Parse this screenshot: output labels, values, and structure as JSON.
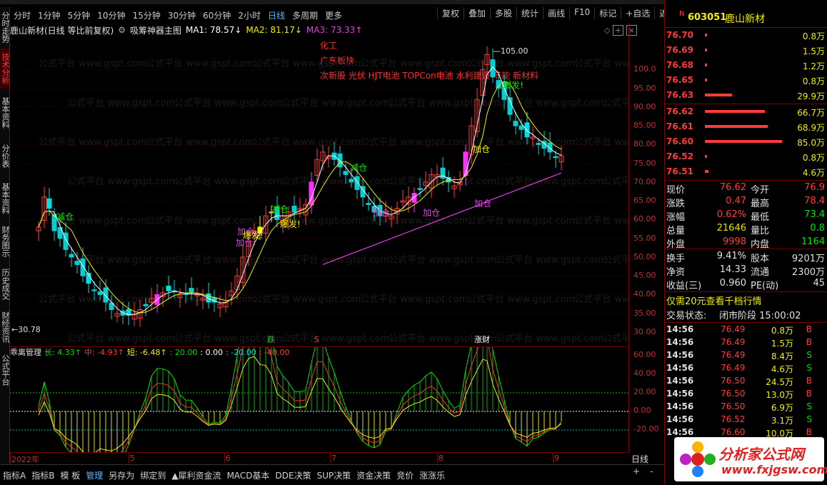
{
  "toolbar": {
    "left": [
      "分时",
      "1分钟",
      "5分钟",
      "10分钟",
      "15分钟",
      "30分钟",
      "60分钟",
      "2小时",
      "日线",
      "多周期",
      "更多"
    ],
    "active": "日线",
    "right": [
      "复权",
      "叠加",
      "多股",
      "统计",
      "画线",
      "F10",
      "标记",
      "+自选",
      "返回"
    ]
  },
  "lefttabs": [
    "分时走势",
    "技术分析",
    "基本资料",
    "分价表",
    "基本资料",
    "财务图示",
    "历史成交",
    "财经资讯",
    "公式平台"
  ],
  "info": {
    "title": "鹿山新材(日线 等比前复权)",
    "indicator": "吸筹神器主图",
    "ma1": "MA1: 78.57↓",
    "ma2": "MA2: 81.17↓",
    "ma3": "MA3: 73.33↑"
  },
  "annotations": {
    "line1": "化工",
    "line2": "广东板块",
    "line3": "次新股 光伏 HJT电池 TOPCon电池 水利建设 节能 新材料"
  },
  "price_labels": {
    "high": "105.00",
    "low": "30.78"
  },
  "signals": [
    "减仓",
    "减仓",
    "减仓",
    "加仓",
    "加仓",
    "加仓",
    "加仓",
    "爆发!",
    "爆发!",
    "爆发!",
    "加仓",
    "加仓"
  ],
  "markers": {
    "m1": "跌",
    "m2": "S",
    "m3": "涨财"
  },
  "yaxis": [
    "100.0",
    "95.00",
    "90.00",
    "85.00",
    "80.00",
    "75.00",
    "70.00",
    "65.00",
    "60.00",
    "55.00",
    "50.00",
    "45.00",
    "40.00",
    "35.00",
    "30.00"
  ],
  "sub_yaxis": [
    "60.00",
    "40.00",
    "20.00",
    "0.00",
    "-20.00"
  ],
  "sub_info": {
    "name": "乖离管理",
    "chang": "长: 4.33↑",
    "zhong": "中: -4.93↑",
    "duan": "短: -6.48↑",
    "v1": ": 20.00",
    "v2": ": 0.00",
    "v3": ": -20.00",
    "v4": ": -40.00"
  },
  "xaxis": [
    "2022年",
    "5",
    "6",
    "7",
    "8",
    "9"
  ],
  "xaxis_period": "日线",
  "bottom_tabs": [
    "指标A",
    "指标B",
    "模 板",
    "管理",
    "另存为",
    "绑定到",
    "▲犀利资金流",
    "MACD基本",
    "DDE决策",
    "SUP决策",
    "资金决策",
    "竞价",
    "涨涨乐"
  ],
  "bottom_active": "管理",
  "bottom_controls": [
    "+",
    "-"
  ],
  "rp": {
    "badge": "N",
    "code": "603051",
    "name": "鹿山新材",
    "asks": [
      {
        "p": "76.70",
        "v": "0.8万",
        "w": 3
      },
      {
        "p": "76.69",
        "v": "1.5万",
        "w": 3
      },
      {
        "p": "76.68",
        "v": "1.2万",
        "w": 3
      },
      {
        "p": "76.65",
        "v": "0.8万",
        "w": 3
      },
      {
        "p": "76.63",
        "v": "29.9万",
        "w": 38
      }
    ],
    "bids": [
      {
        "p": "76.62",
        "v": "66.7万",
        "w": 84
      },
      {
        "p": "76.61",
        "v": "68.9万",
        "w": 88
      },
      {
        "p": "76.60",
        "v": "85.0万",
        "w": 108
      },
      {
        "p": "76.52",
        "v": "0.8万",
        "w": 3
      },
      {
        "p": "76.51",
        "v": "4.6万",
        "w": 5
      }
    ],
    "stats": [
      {
        "l": "现价",
        "v": "76.62",
        "l2": "今开",
        "v2": "76.9",
        "c": "#ff3c3c",
        "c2": "#ff3c3c"
      },
      {
        "l": "涨跌",
        "v": "0.47",
        "l2": "最高",
        "v2": "78.4",
        "c": "#ff3c3c",
        "c2": "#ff3c3c"
      },
      {
        "l": "涨幅",
        "v": "0.62%",
        "l2": "最低",
        "v2": "73.4",
        "c": "#ff3c3c",
        "c2": "#00e000"
      },
      {
        "l": "总量",
        "v": "21646",
        "l2": "量比",
        "v2": "0.8",
        "c": "#e0e000",
        "c2": "#00e000"
      },
      {
        "l": "外盘",
        "v": "9998",
        "l2": "内盘",
        "v2": "1164",
        "c": "#ff3c3c",
        "c2": "#00e000"
      }
    ],
    "stats2": [
      {
        "l": "换手",
        "v": "9.41%",
        "l2": "股本",
        "v2": "9201万"
      },
      {
        "l": "净资",
        "v": "14.33",
        "l2": "流通",
        "v2": "2300万"
      },
      {
        "l": "收益(三)",
        "v": "0.960",
        "l2": "PE(动)",
        "v2": "45"
      }
    ],
    "promo": "仅需20元查看千档行情",
    "status_label": "交易状态:",
    "status_value": "闭市阶段 15:00:02",
    "ticks": [
      {
        "t": "14:56",
        "p": "76.49",
        "v": "0.8万",
        "s": "B"
      },
      {
        "t": "14:56",
        "p": "76.49",
        "v": "1.5万",
        "s": "B"
      },
      {
        "t": "14:56",
        "p": "76.49",
        "v": "8.4万",
        "s": "S"
      },
      {
        "t": "14:56",
        "p": "76.49",
        "v": "4.6万",
        "s": "S"
      },
      {
        "t": "14:56",
        "p": "76.50",
        "v": "24.5万",
        "s": "B"
      },
      {
        "t": "14:56",
        "p": "76.50",
        "v": "13.0万",
        "s": "B"
      },
      {
        "t": "14:56",
        "p": "76.50",
        "v": "6.9万",
        "s": "S"
      },
      {
        "t": "14:56",
        "p": "76.52",
        "v": "3.1万",
        "s": "S"
      },
      {
        "t": "14:56",
        "p": "76.60",
        "v": "10.0万",
        "s": "B"
      }
    ]
  },
  "watermark": "公式平台 www.gspt.com",
  "logo": {
    "title": "分析家公式网",
    "url": "www.fxjgsw.com"
  },
  "colors": {
    "up": "#ff3c3c",
    "down": "#00e0e0",
    "magenta": "#ff30ff",
    "ma_white": "#ffffff",
    "ma_yellow": "#f0f000",
    "ma_purple": "#e040e0",
    "axis_red": "#c03030"
  }
}
